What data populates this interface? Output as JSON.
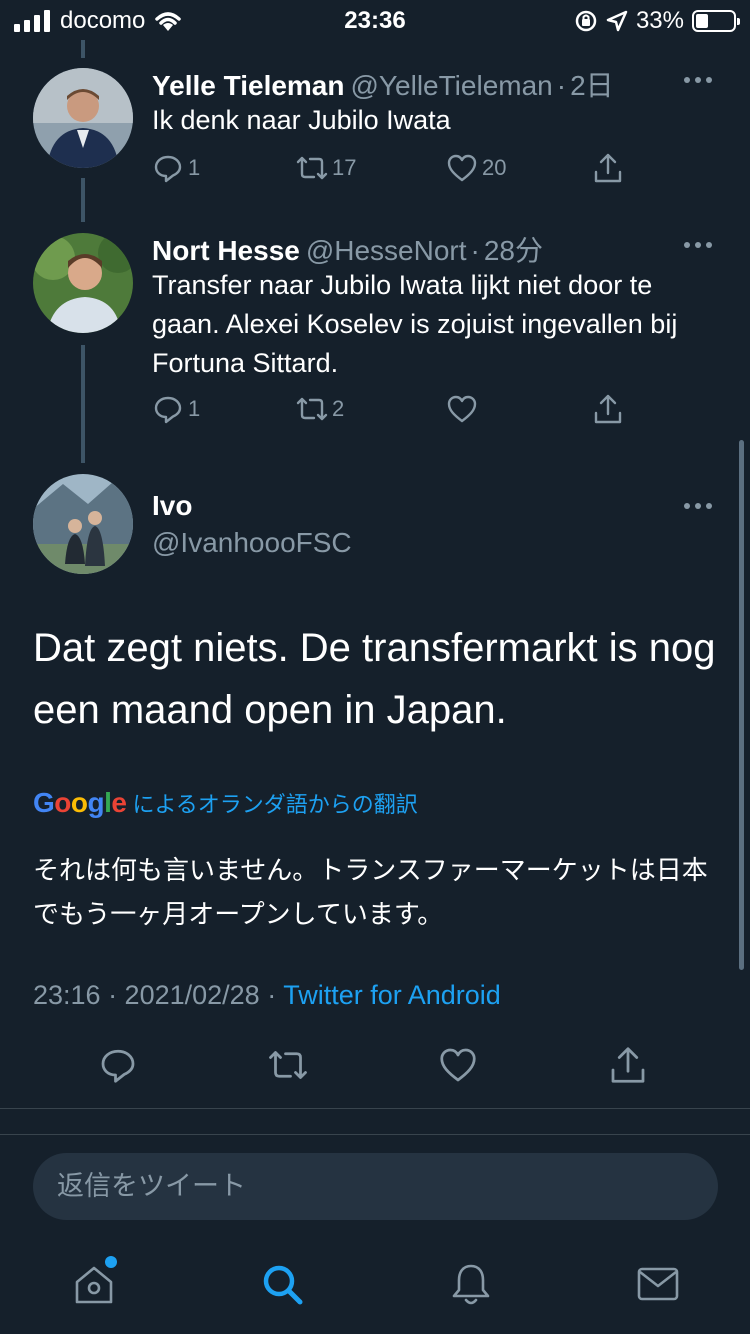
{
  "status": {
    "carrier": "docomo",
    "time": "23:36",
    "battery": "33%"
  },
  "thread": [
    {
      "name": "Yelle Tieleman",
      "handle": "@YelleTieleman",
      "time": "2日",
      "text": "Ik denk naar Jubilo Iwata",
      "replies": "1",
      "retweets": "17",
      "likes": "20"
    },
    {
      "name": "Nort Hesse",
      "handle": "@HesseNort",
      "time": "28分",
      "text": "Transfer naar Jubilo Iwata lijkt niet door te gaan. Alexei Koselev is zojuist ingevallen bij Fortuna Sittard.",
      "replies": "1",
      "retweets": "2",
      "likes": ""
    }
  ],
  "focused": {
    "name": "Ivo",
    "handle": "@IvanhoooFSC",
    "text": "Dat zegt niets. De transfermarkt is nog een maand open in Japan.",
    "translate_brand": "Google",
    "translate_label": "によるオランダ語からの翻訳",
    "translation": "それは何も言いません。トランスファーマーケットは日本でもう一ヶ月オープンしています。",
    "timestamp": "23:16 · 2021/02/28 · ",
    "source": "Twitter for Android"
  },
  "reply": {
    "placeholder": "返信をツイート"
  },
  "colors": {
    "background": "#15202b",
    "accent": "#1da1f2",
    "muted": "#8899a6"
  },
  "tabs": [
    "home-icon",
    "search-icon",
    "bell-icon",
    "mail-icon"
  ]
}
